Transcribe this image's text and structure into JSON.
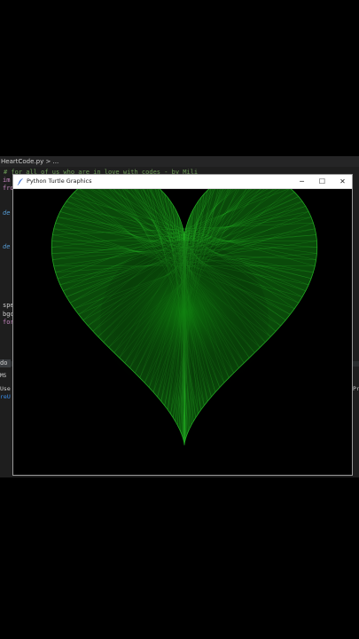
{
  "editor": {
    "tab_path": "HeartCode.py > ...",
    "comment_line": "# for all of us who are in love with codes - by Mili",
    "lines": [
      {
        "text": "im",
        "cls": "kw"
      },
      {
        "text": "fro",
        "cls": "kw"
      },
      {
        "text": "de",
        "cls": "fn"
      },
      {
        "text": "de",
        "cls": "fn"
      },
      {
        "text": "spe",
        "cls": "plain"
      },
      {
        "text": "bgc",
        "cls": "plain"
      },
      {
        "text": "for",
        "cls": "kw"
      }
    ],
    "selected_text": "do",
    "terminal_label": "MS",
    "terminal_line1": "Use",
    "terminal_line2": "reU",
    "right_edge_text": "Pr"
  },
  "window": {
    "title": "Python Turtle Graphics",
    "minimize_glyph": "─",
    "maximize_glyph": "☐",
    "close_glyph": "✕"
  },
  "drawing": {
    "shape": "heart",
    "line_color": "#22aa22",
    "background": "#000000",
    "fill_glow": "#0e7d0e"
  }
}
